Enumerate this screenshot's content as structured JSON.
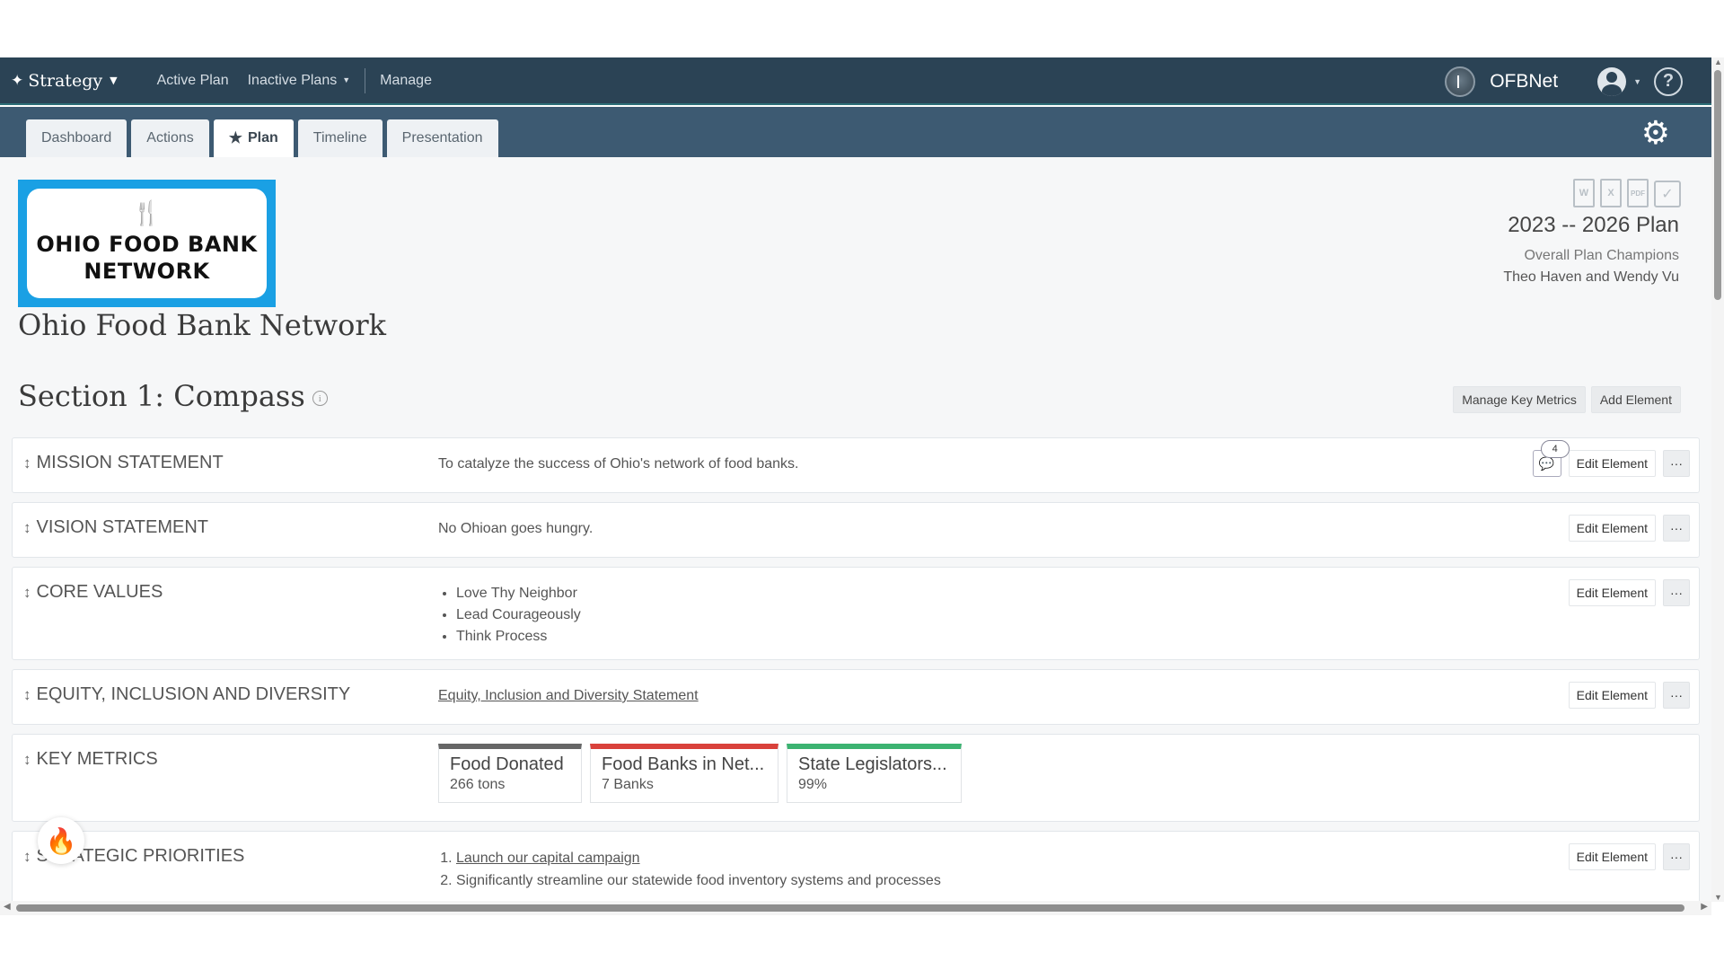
{
  "nav": {
    "brand": "Strategy",
    "links": [
      "Active Plan",
      "Inactive Plans",
      "Manage"
    ],
    "org_name": "OFBNet"
  },
  "tabs": [
    {
      "label": "Dashboard"
    },
    {
      "label": "Actions"
    },
    {
      "label": "Plan",
      "active": true
    },
    {
      "label": "Timeline"
    },
    {
      "label": "Presentation"
    }
  ],
  "logo": {
    "line1": "OHIO FOOD BANK",
    "line2": "NETWORK"
  },
  "org_title": "Ohio Food Bank Network",
  "plan": {
    "years": "2023 -- 2026 Plan",
    "champions_label": "Overall Plan Champions",
    "champions": "Theo Haven and Wendy Vu",
    "export_icons": [
      "word-icon",
      "excel-icon",
      "pdf-icon",
      "calendar-check-icon"
    ]
  },
  "section": {
    "title": "Section 1: Compass",
    "manage_metrics": "Manage Key Metrics",
    "add_element": "Add Element"
  },
  "elements": {
    "mission": {
      "label": "MISSION STATEMENT",
      "value": "To catalyze the success of Ohio's network of food banks.",
      "comment_count": "4"
    },
    "vision": {
      "label": "VISION STATEMENT",
      "value": "No Ohioan goes hungry."
    },
    "core_values": {
      "label": "CORE VALUES",
      "items": [
        "Love Thy Neighbor",
        "Lead Courageously",
        "Think Process"
      ]
    },
    "equity": {
      "label": "EQUITY, INCLUSION AND DIVERSITY",
      "link": "Equity, Inclusion and Diversity Statement"
    },
    "key_metrics": {
      "label": "KEY METRICS",
      "metrics": [
        {
          "title": "Food Donated",
          "value": "266 tons",
          "color": "#666666"
        },
        {
          "title": "Food Banks in Net...",
          "value": "7 Banks",
          "color": "#d9413b"
        },
        {
          "title": "State Legislators...",
          "value": "99%",
          "color": "#3cb371"
        }
      ]
    },
    "priorities": {
      "label": "STRATEGIC PRIORITIES",
      "items": [
        "Launch our capital campaign",
        "Significantly streamline our statewide food inventory systems and processes"
      ]
    }
  },
  "edit_label": "Edit Element",
  "more_label": "···"
}
